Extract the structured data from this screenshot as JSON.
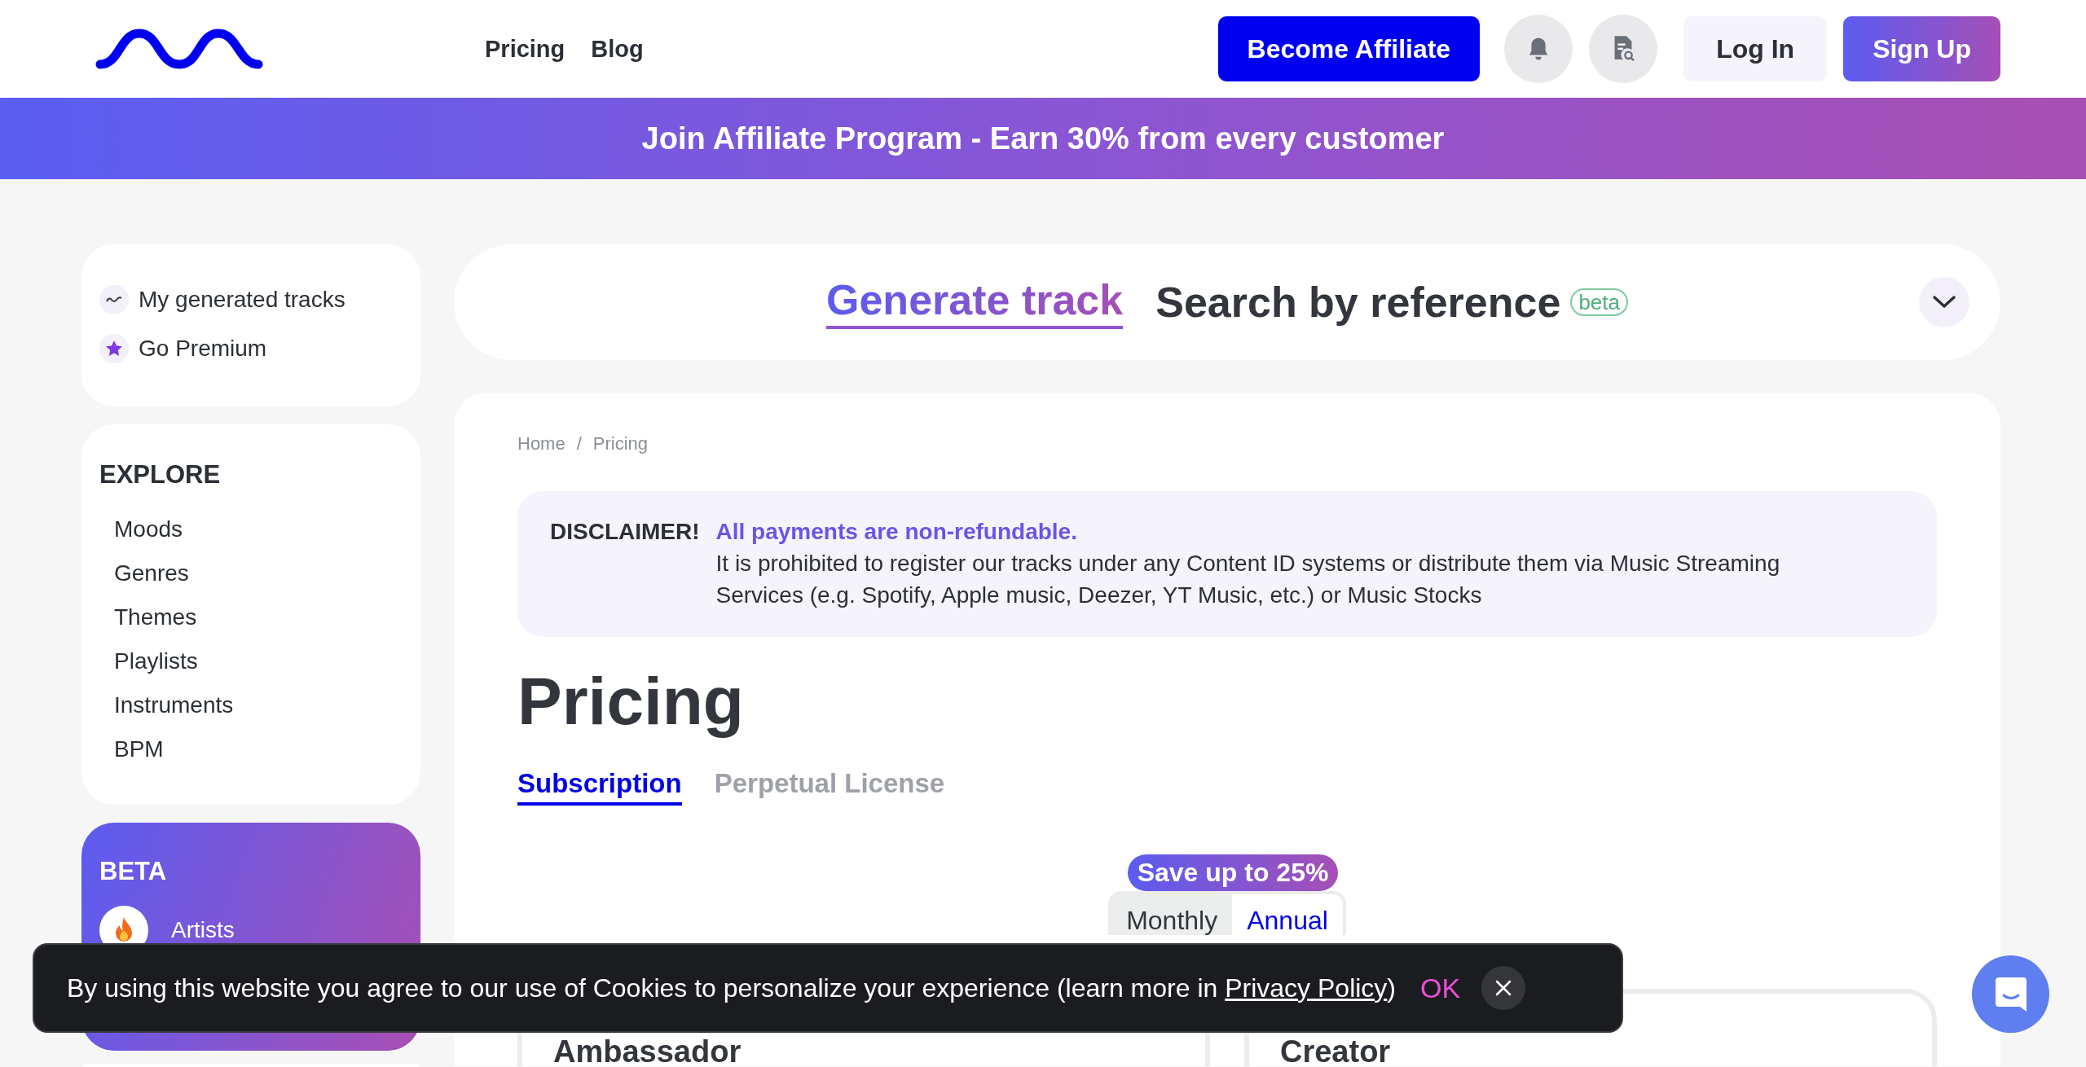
{
  "header": {
    "nav": [
      "Pricing",
      "Blog"
    ],
    "affiliate_button": "Become Affiliate",
    "login_button": "Log In",
    "signup_button": "Sign Up"
  },
  "banner": {
    "text": "Join Affiliate Program - Earn 30% from every customer"
  },
  "sidebar": {
    "quick_links": [
      {
        "label": "My generated tracks",
        "kind": "tracks"
      },
      {
        "label": "Go Premium",
        "kind": "premium"
      }
    ],
    "explore": {
      "title": "EXPLORE",
      "items": [
        "Moods",
        "Genres",
        "Themes",
        "Playlists",
        "Instruments",
        "BPM"
      ]
    },
    "beta": {
      "title": "BETA",
      "items": [
        {
          "label": "Artists",
          "kind": "fire"
        }
      ]
    }
  },
  "mode_tabs": [
    {
      "label": "Generate track",
      "selected": true
    },
    {
      "label": "Search by reference",
      "selected": false,
      "badge": "beta"
    }
  ],
  "breadcrumb": {
    "separator": "/",
    "items": [
      "Home",
      "Pricing"
    ]
  },
  "disclaimer": {
    "label": "DISCLAIMER!",
    "highlight": "All payments are non-refundable.",
    "text": "It is prohibited to register our tracks under any Content ID systems or distribute them via Music Streaming Services (e.g. Spotify, Apple music, Deezer, YT Music, etc.) or Music Stocks"
  },
  "title": "Pricing",
  "license_tabs": [
    {
      "label": "Subscription",
      "selected": true
    },
    {
      "label": "Perpetual License",
      "selected": false
    }
  ],
  "billing": {
    "badge": "Save up to 25%",
    "options": [
      {
        "label": "Monthly",
        "selected": false
      },
      {
        "label": "Annual",
        "selected": true
      }
    ]
  },
  "plans": [
    {
      "name": "Ambassador"
    },
    {
      "name": "Creator"
    }
  ],
  "cookie_notice": {
    "text": "By using this website you agree to our use of Cookies to personalize your experience (learn more in ",
    "link": "Privacy Policy",
    "text_end": ")",
    "ok": "OK"
  }
}
